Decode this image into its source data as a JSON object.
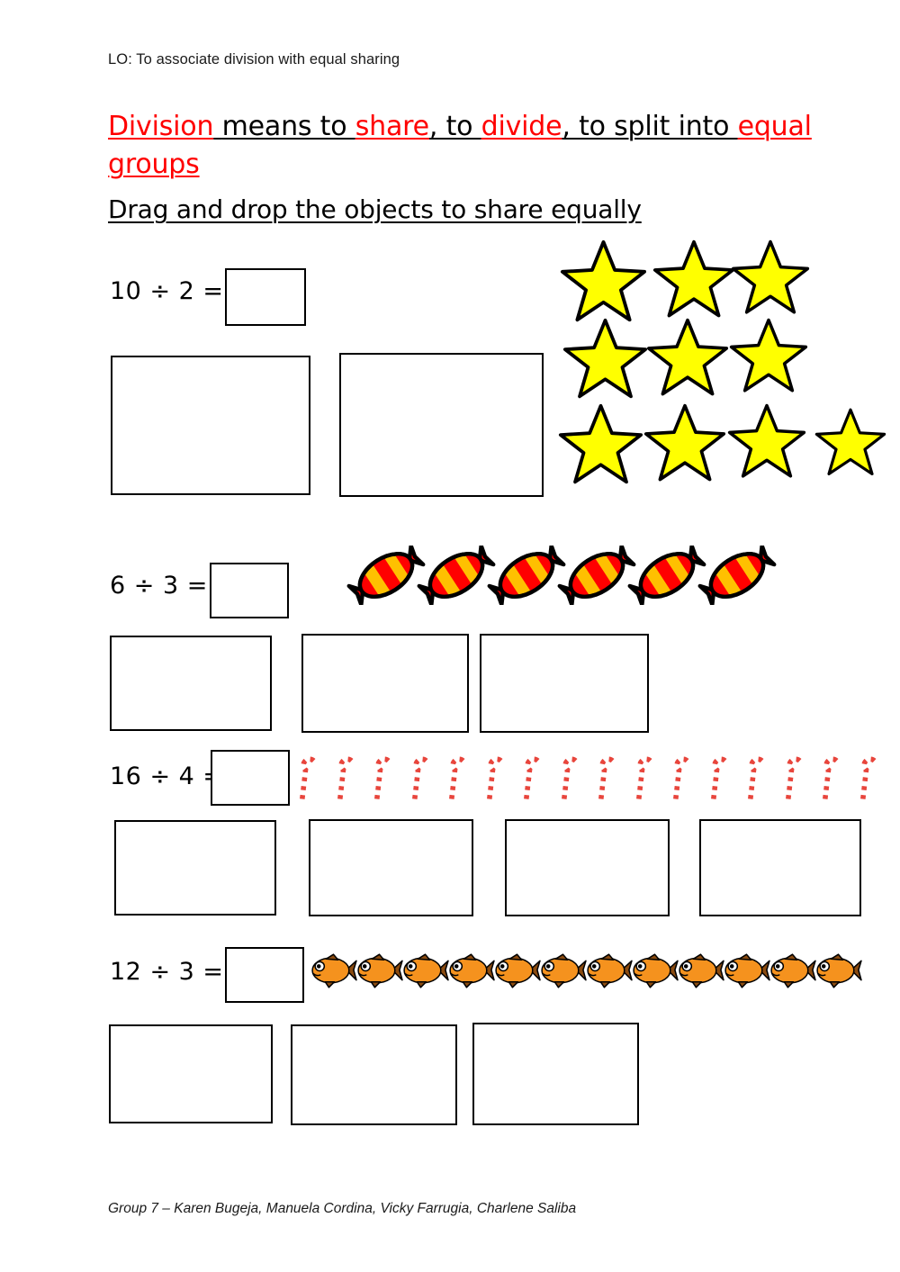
{
  "page": {
    "lo_line": "LO: To associate division with equal sharing",
    "instruction": "Drag and drop the objects to share equally",
    "footer": "Group 7 – Karen Bugeja, Manuela Cordina, Vicky Farrugia, Charlene Saliba"
  },
  "title": {
    "parts": [
      {
        "text": "Division",
        "color": "red"
      },
      {
        "text": " ",
        "color": "black"
      },
      {
        "text": "means to ",
        "color": "black"
      },
      {
        "text": "share",
        "color": "red"
      },
      {
        "text": ", to ",
        "color": "black"
      },
      {
        "text": "divide",
        "color": "red"
      },
      {
        "text": ", to split into ",
        "color": "black"
      },
      {
        "text": "equal groups",
        "color": "red"
      }
    ],
    "full_text": "Division means to share, to divide, to split into equal groups",
    "red_hex": "#ff0000",
    "black_hex": "#000000"
  },
  "problems": [
    {
      "id": "problem-1",
      "equation": "10 ÷ 2 =",
      "dividend": 10,
      "divisor": 2,
      "answer_value": "",
      "object_type": "star",
      "object_count": 10,
      "object_color": "#ffff00",
      "object_outline": "#000000",
      "drop_zone_count": 2
    },
    {
      "id": "problem-2",
      "equation": "6 ÷ 3 =",
      "dividend": 6,
      "divisor": 3,
      "answer_value": "",
      "object_type": "candy",
      "object_count": 6,
      "object_color": "#ff0000",
      "object_color_secondary": "#ffc000",
      "drop_zone_count": 3
    },
    {
      "id": "problem-3",
      "equation": "16 ÷ 4 =",
      "dividend": 16,
      "divisor": 4,
      "answer_value": "",
      "object_type": "candy-cane",
      "object_count": 16,
      "object_color": "#e8453c",
      "object_color_secondary": "#ffffff",
      "drop_zone_count": 4
    },
    {
      "id": "problem-4",
      "equation": "12 ÷ 3 =",
      "dividend": 12,
      "divisor": 3,
      "answer_value": "",
      "object_type": "fish",
      "object_count": 12,
      "object_color": "#f5921e",
      "object_outline": "#8a4b10",
      "drop_zone_count": 3
    }
  ]
}
